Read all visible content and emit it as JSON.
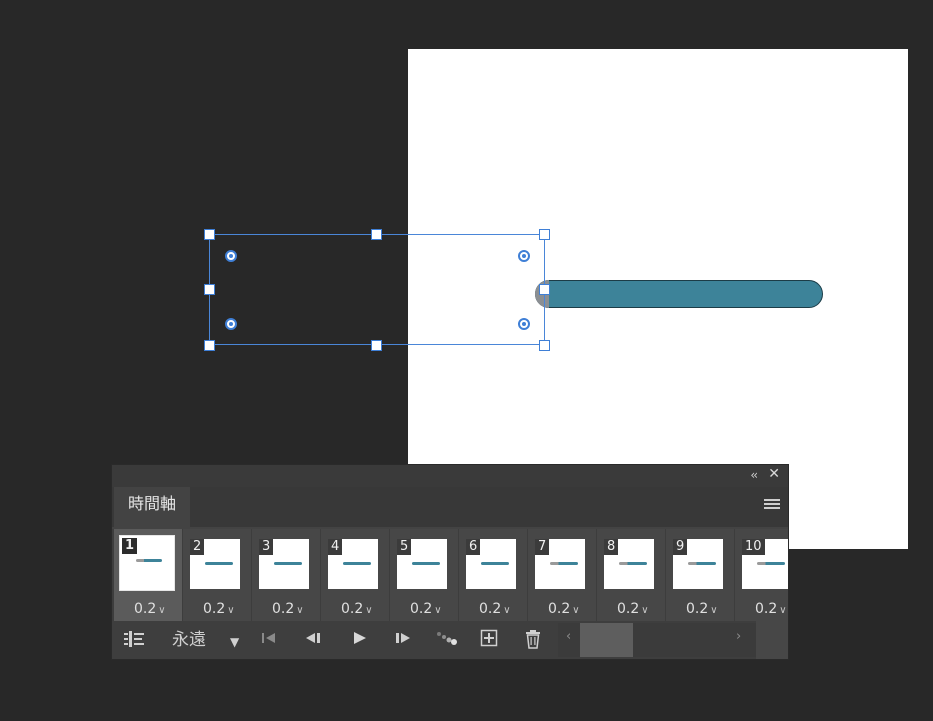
{
  "panel": {
    "tab_label": "時間軸",
    "collapse_glyph": "‹‹",
    "close_glyph": "✕"
  },
  "frames": [
    {
      "number": "1",
      "delay": "0.2",
      "selected": true,
      "thumb": "grey"
    },
    {
      "number": "2",
      "delay": "0.2",
      "selected": false,
      "thumb": "color"
    },
    {
      "number": "3",
      "delay": "0.2",
      "selected": false,
      "thumb": "color"
    },
    {
      "number": "4",
      "delay": "0.2",
      "selected": false,
      "thumb": "color"
    },
    {
      "number": "5",
      "delay": "0.2",
      "selected": false,
      "thumb": "color"
    },
    {
      "number": "6",
      "delay": "0.2",
      "selected": false,
      "thumb": "color"
    },
    {
      "number": "7",
      "delay": "0.2",
      "selected": false,
      "thumb": "grey"
    },
    {
      "number": "8",
      "delay": "0.2",
      "selected": false,
      "thumb": "grey"
    },
    {
      "number": "9",
      "delay": "0.2",
      "selected": false,
      "thumb": "grey"
    },
    {
      "number": "10",
      "delay": "0.2",
      "selected": false,
      "thumb": "grey"
    }
  ],
  "controls": {
    "loop_option": "永遠",
    "dropdown_glyph": "▼",
    "first_frame_glyph": "|◀",
    "prev_frame_glyph": "◀|",
    "play_glyph": "▶",
    "next_frame_glyph": "|▶",
    "tween_glyph": "⋱",
    "new_frame_glyph": "⊞",
    "delete_glyph": "🗑",
    "scroll_left_glyph": "‹",
    "scroll_right_glyph": "›"
  },
  "colors": {
    "canvas_bg": "#282828",
    "document": "#ffffff",
    "bar_fill": "#3d8399",
    "selection": "#4a86d8",
    "panel_bg": "#434343"
  }
}
